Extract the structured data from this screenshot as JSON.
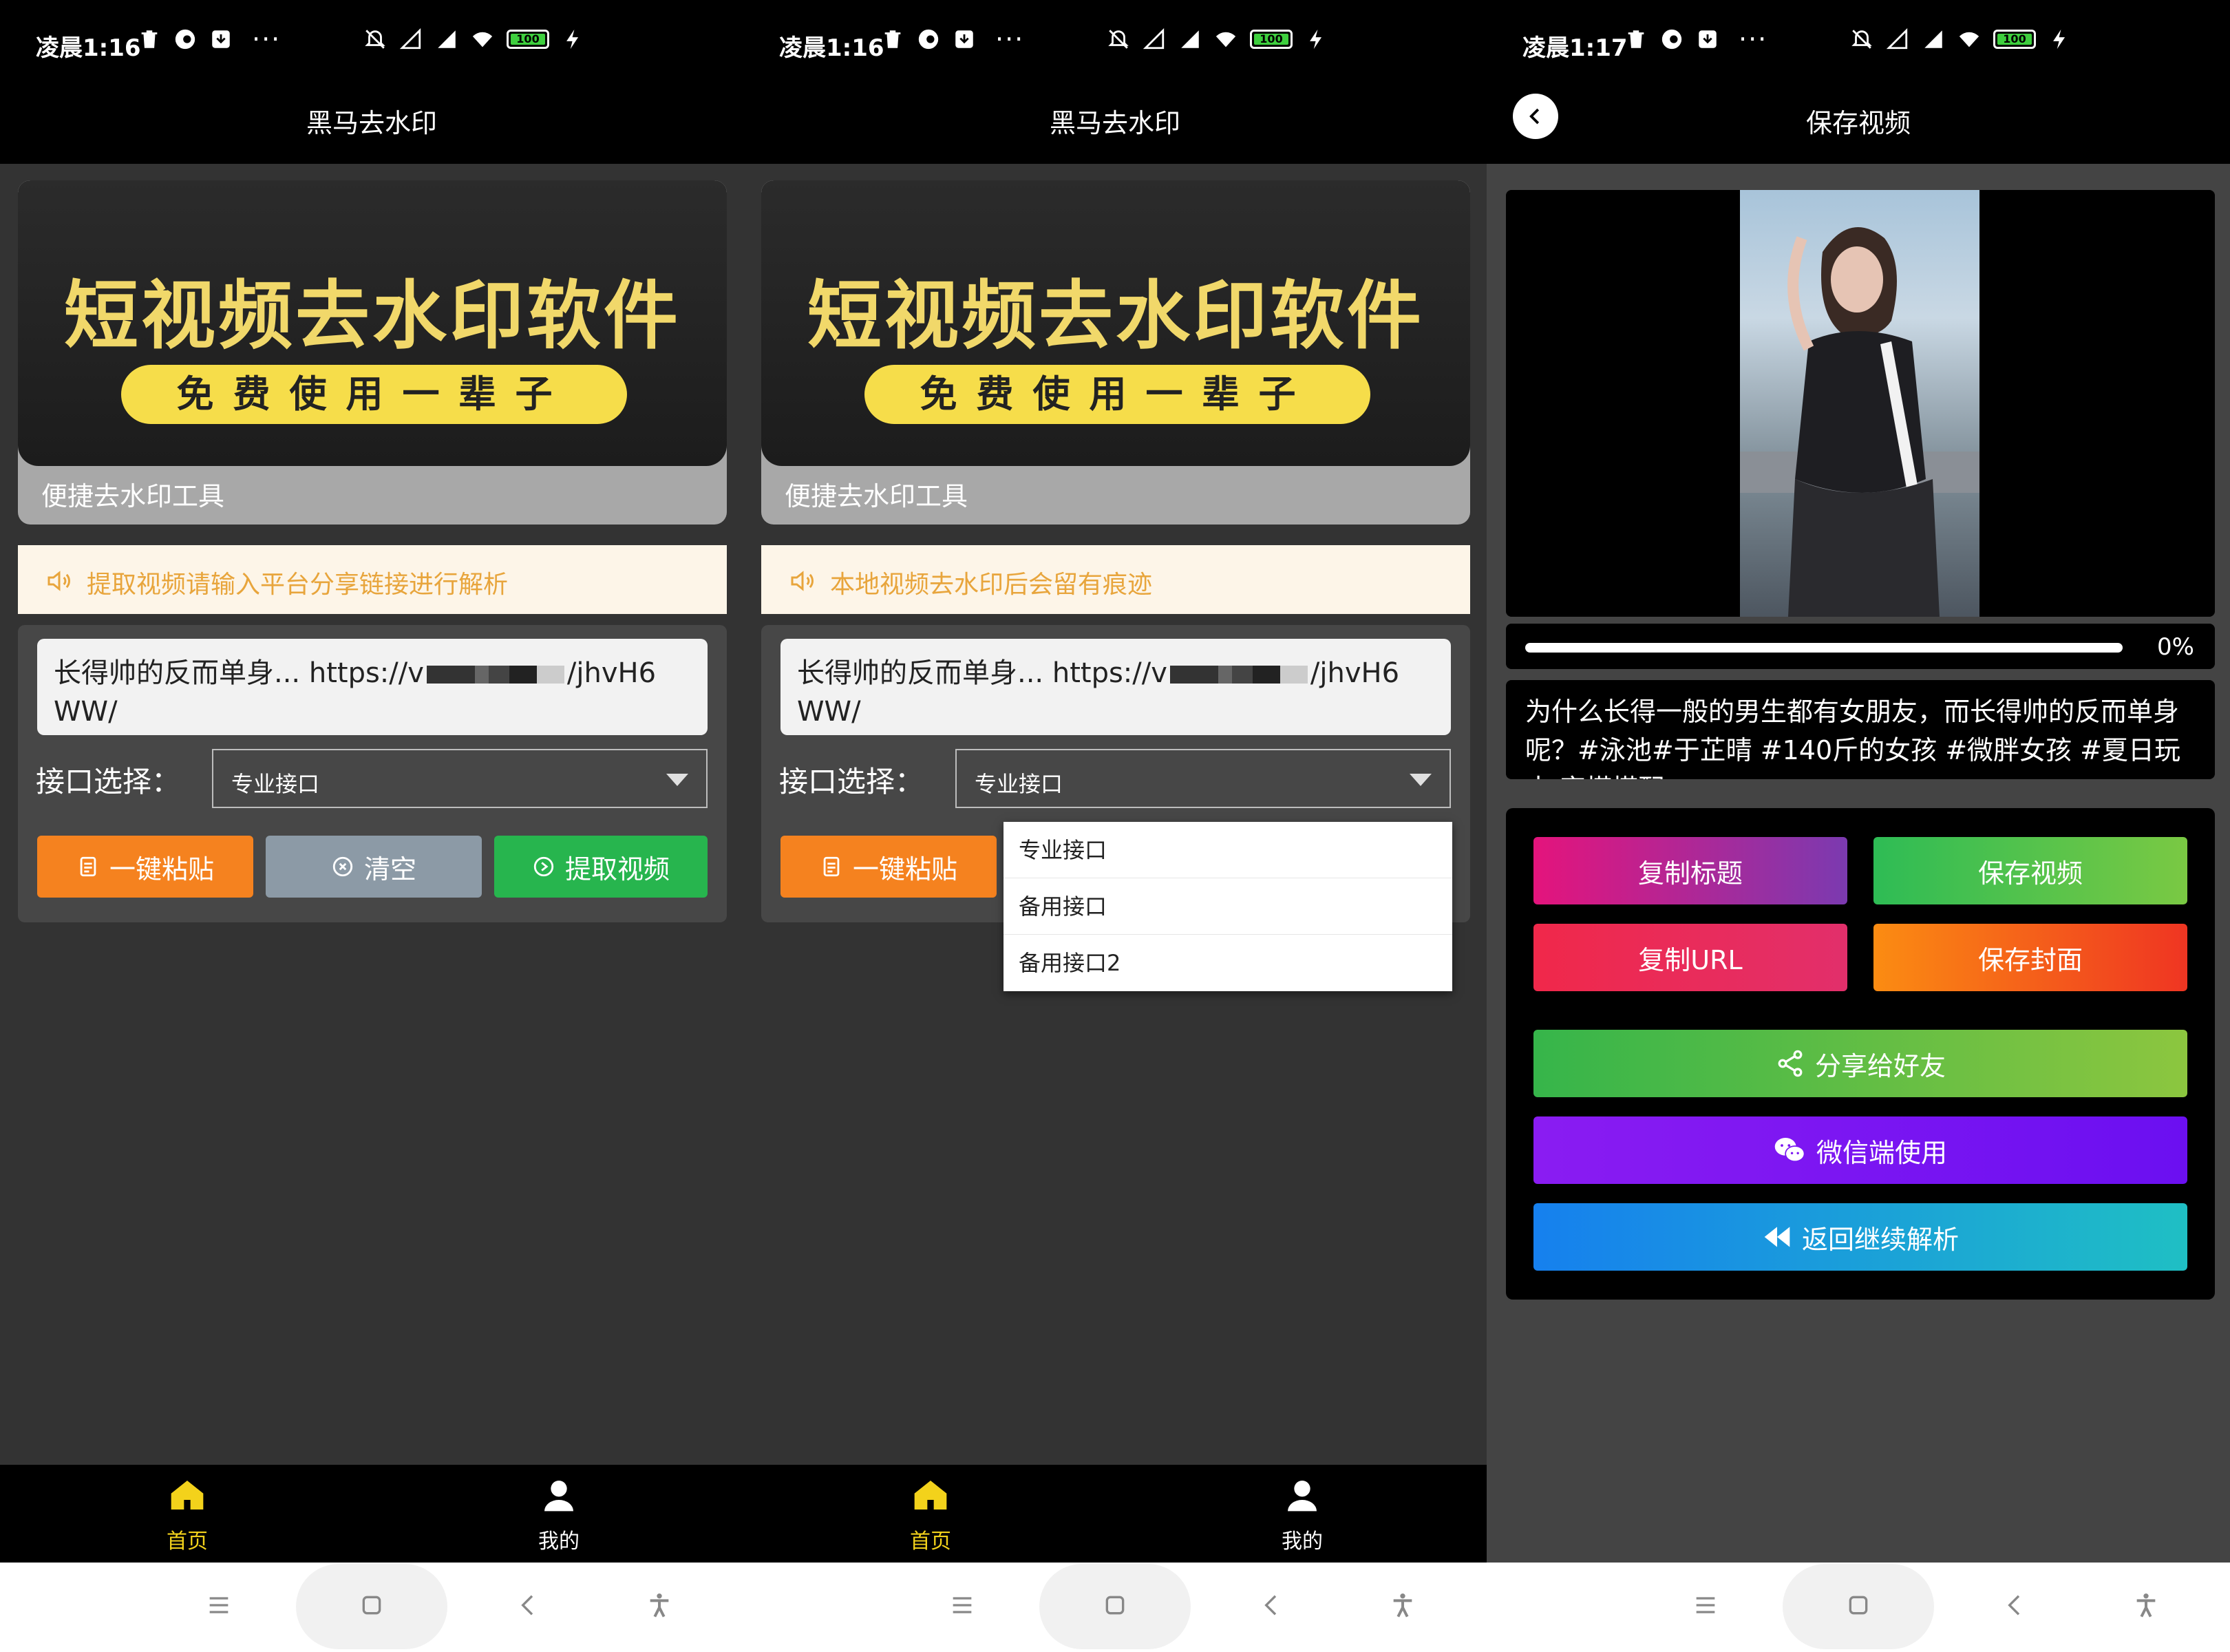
{
  "colors": {
    "status_bg": "#000000",
    "page_bg": "#333333",
    "accent_yellow": "#f3d21b",
    "paste_orange": "#f5821f",
    "clear_gray": "#8c9aa6",
    "extract_green": "#27b54e",
    "notice_text": "#e8a53c"
  },
  "screens": [
    {
      "status": {
        "time": "凌晨1:16",
        "battery": "100"
      },
      "header": {
        "title": "黑马去水印"
      },
      "banner": {
        "headline": "短视频去水印软件",
        "pill": "免费使用一辈子",
        "caption": "便捷去水印工具"
      },
      "notice": {
        "text": "提取视频请输入平台分享链接进行解析",
        "icon": "speaker-icon"
      },
      "form": {
        "url_prefix": "长得帅的反而单身... https://v",
        "url_suffix": "/jhvH6",
        "url_line2": "WW/",
        "interface_label": "接口选择：",
        "interface_value": "专业接口",
        "buttons": {
          "paste": "一键粘贴",
          "clear": "清空",
          "extract": "提取视频"
        }
      },
      "tabs": [
        {
          "label": "首页",
          "icon": "home-icon"
        },
        {
          "label": "我的",
          "icon": "user-icon"
        }
      ]
    },
    {
      "status": {
        "time": "凌晨1:16",
        "battery": "100"
      },
      "header": {
        "title": "黑马去水印"
      },
      "banner": {
        "headline": "短视频去水印软件",
        "pill": "免费使用一辈子",
        "caption": "便捷去水印工具"
      },
      "notice": {
        "text": "本地视频去水印后会留有痕迹",
        "icon": "speaker-icon"
      },
      "form": {
        "url_prefix": "长得帅的反而单身... https://v",
        "url_suffix": "/jhvH6",
        "url_line2": "WW/",
        "interface_label": "接口选择：",
        "interface_value": "专业接口",
        "buttons": {
          "paste": "一键粘贴"
        }
      },
      "dropdown_options": [
        "专业接口",
        "备用接口",
        "备用接口2"
      ],
      "tabs": [
        {
          "label": "首页",
          "icon": "home-icon"
        },
        {
          "label": "我的",
          "icon": "user-icon"
        }
      ]
    },
    {
      "status": {
        "time": "凌晨1:17",
        "battery": "100"
      },
      "header": {
        "title": "保存视频",
        "back_icon": "chevron-left-icon"
      },
      "progress": {
        "value": 0,
        "label": "0%"
      },
      "description": "为什么长得一般的男生都有女朋友，而长得帅的反而单身呢？#泳池#于芷晴 #140斤的女孩 #微胖女孩 #夏日玩水 穿搭搭配",
      "actions": {
        "copy_title": "复制标题",
        "save_video": "保存视频",
        "copy_url": "复制URL",
        "save_cover": "保存封面",
        "share": "分享给好友",
        "wechat": "微信端使用",
        "back_parse": "返回继续解析"
      }
    }
  ]
}
